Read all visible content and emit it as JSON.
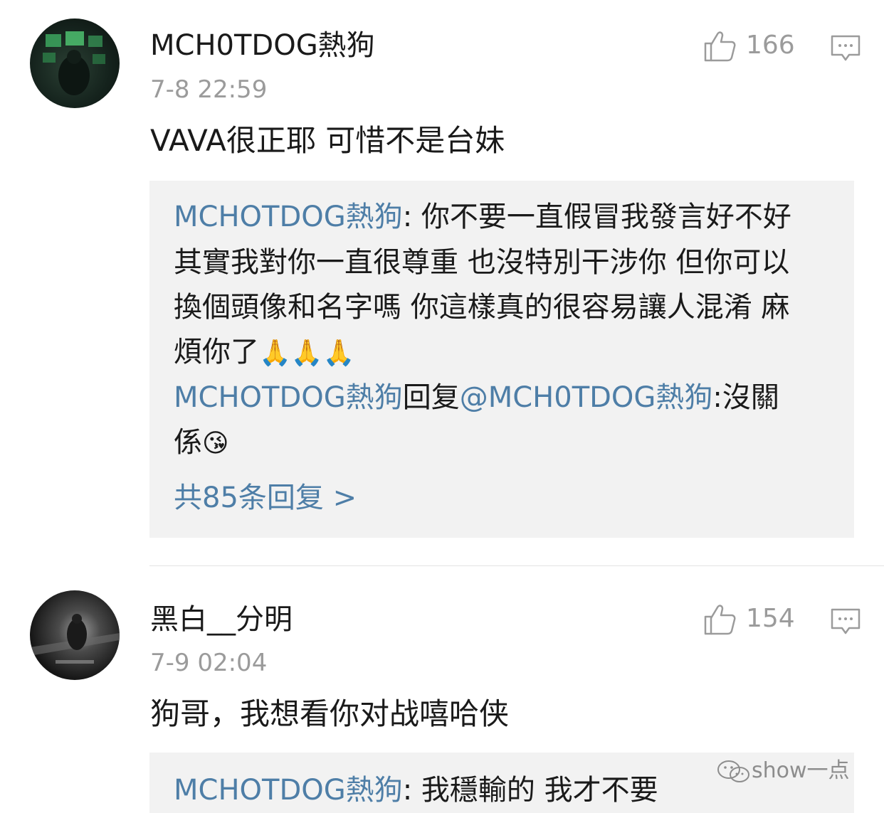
{
  "comments": [
    {
      "username": "MCH0TDOG熱狗",
      "time": "7-8 22:59",
      "likes": "166",
      "text": "VAVA很正耶 可惜不是台妹",
      "replies": {
        "line1_name": "MCHOTDOG熱狗",
        "line1_text": ": 你不要一直假冒我發言好不好",
        "line2": "其實我對你一直很尊重 也沒特別干涉你 但你可以",
        "line3": "換個頭像和名字嗎 你這樣真的很容易讓人混淆 麻",
        "line4": "煩你了",
        "line4_emoji": "🙏🙏🙏",
        "line5_name": "MCHOTDOG熱狗",
        "line5_mid": "回复",
        "line5_mention": "@MCH0TDOG熱狗",
        "line5_text": ":沒關",
        "line6": "係",
        "line6_emoji": "😘",
        "more": "共85条回复 >"
      }
    },
    {
      "username": "黑白__分明",
      "time": "7-9 02:04",
      "likes": "154",
      "text": "狗哥，我想看你对战嘻哈侠",
      "replies": {
        "line1_name": "MCHOTDOG熱狗",
        "line1_text": ": 我穩輸的 我才不要"
      }
    }
  ],
  "watermark": "show一点",
  "icons": [
    "thumbs-up-icon",
    "reply-icon",
    "wechat-icon"
  ],
  "colors": {
    "link": "#4e7ea7",
    "meta": "#9b9b9b",
    "reply_bg": "#f2f2f2"
  }
}
